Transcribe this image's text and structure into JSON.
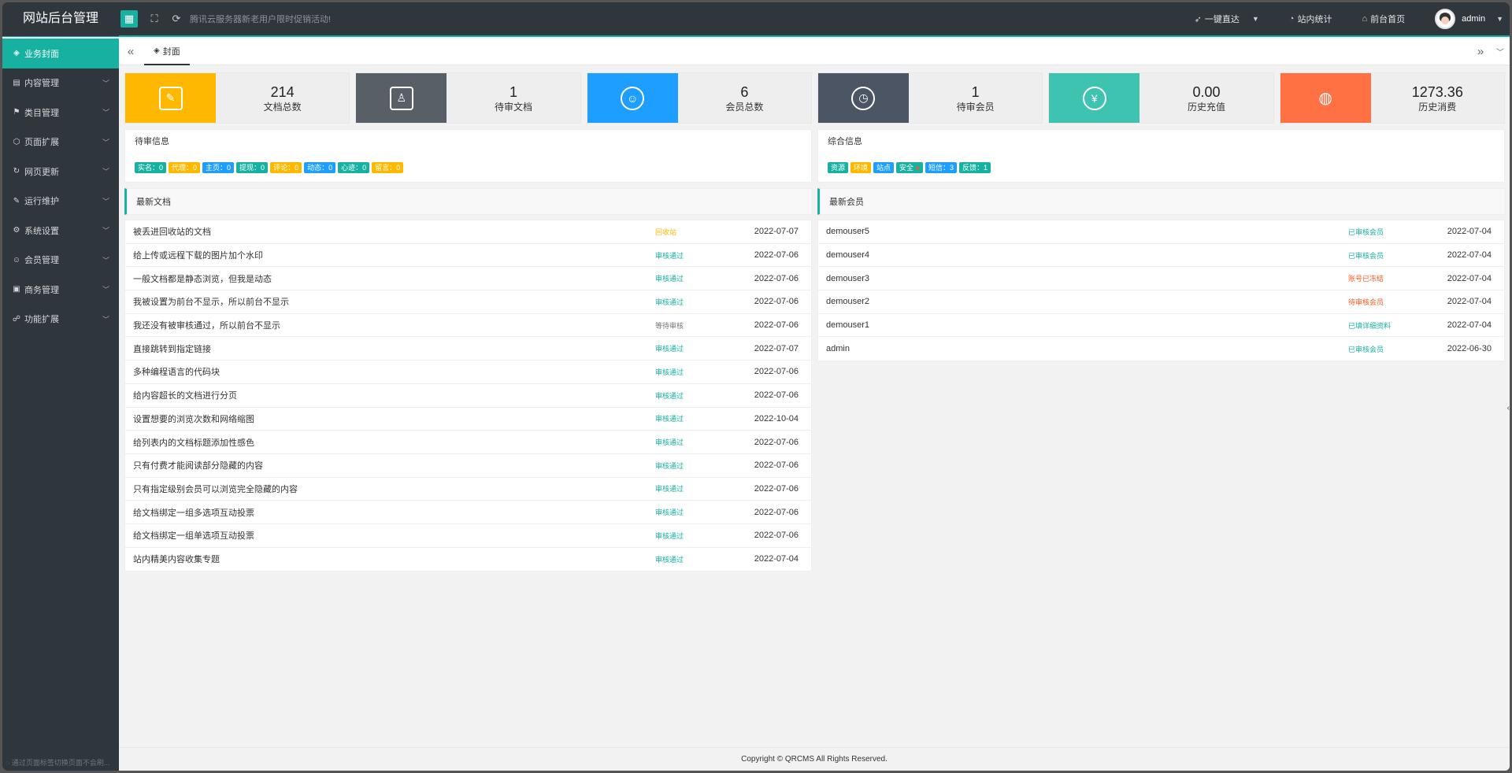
{
  "header": {
    "title": "网站后台管理",
    "notice": "腾讯云服务器新老用户限时促销活动!",
    "quick_link": "一键直达",
    "stats_link": "站内统计",
    "home_link": "前台首页",
    "user": "admin"
  },
  "sidebar": {
    "items": [
      {
        "label": "业务封面",
        "icon": "cover-icon"
      },
      {
        "label": "内容管理",
        "icon": "content-icon"
      },
      {
        "label": "类目管理",
        "icon": "category-icon"
      },
      {
        "label": "页面扩展",
        "icon": "page-icon"
      },
      {
        "label": "网页更新",
        "icon": "update-icon"
      },
      {
        "label": "运行维护",
        "icon": "wrench-icon"
      },
      {
        "label": "系统设置",
        "icon": "gear-icon"
      },
      {
        "label": "会员管理",
        "icon": "user-icon"
      },
      {
        "label": "商务管理",
        "icon": "business-icon"
      },
      {
        "label": "功能扩展",
        "icon": "extension-icon"
      }
    ],
    "footer_tip": "通过页面标签切换页面不会刷..."
  },
  "tabs": {
    "active": "封面"
  },
  "stats": [
    {
      "value": "214",
      "label": "文档总数",
      "color": "#ffb800"
    },
    {
      "value": "1",
      "label": "待审文档",
      "color": "#595f66"
    },
    {
      "value": "6",
      "label": "会员总数",
      "color": "#1e9fff"
    },
    {
      "value": "1",
      "label": "待审会员",
      "color": "#4b5563"
    },
    {
      "value": "0.00",
      "label": "历史充值",
      "color": "#3ec3b0"
    },
    {
      "value": "1273.36",
      "label": "历史消费",
      "color": "#ff7043"
    }
  ],
  "pending": {
    "title": "待审信息",
    "badges": [
      {
        "text": "实名：0",
        "color": "teal"
      },
      {
        "text": "代理：0",
        "color": "orange"
      },
      {
        "text": "主页：0",
        "color": "blue"
      },
      {
        "text": "提现：0",
        "color": "teal"
      },
      {
        "text": "评论：0",
        "color": "orange"
      },
      {
        "text": "动态：0",
        "color": "blue"
      },
      {
        "text": "心迹：0",
        "color": "teal"
      },
      {
        "text": "留言：0",
        "color": "orange"
      }
    ]
  },
  "general": {
    "title": "综合信息",
    "badges": [
      {
        "text": "资源",
        "color": "teal"
      },
      {
        "text": "环境",
        "color": "orange"
      },
      {
        "text": "站点",
        "color": "blue"
      },
      {
        "text": "安全",
        "color": "teal"
      },
      {
        "text": "短信：3",
        "color": "blue"
      },
      {
        "text": "反馈：1",
        "color": "teal"
      }
    ]
  },
  "latest_docs": {
    "title": "最新文档",
    "rows": [
      {
        "title": "被丢进回收站的文档",
        "status": "回收站",
        "tone": "orange",
        "date": "2022-07-07"
      },
      {
        "title": "给上传或远程下载的图片加个水印",
        "status": "审核通过",
        "tone": "green",
        "date": "2022-07-06"
      },
      {
        "title": "一般文档都是静态浏览，但我是动态",
        "status": "审核通过",
        "tone": "green",
        "date": "2022-07-06"
      },
      {
        "title": "我被设置为前台不显示，所以前台不显示",
        "status": "审核通过",
        "tone": "green",
        "date": "2022-07-06"
      },
      {
        "title": "我还没有被审核通过，所以前台不显示",
        "status": "等待审核",
        "tone": "gray",
        "date": "2022-07-06"
      },
      {
        "title": "直接跳转到指定链接",
        "status": "审核通过",
        "tone": "green",
        "date": "2022-07-07"
      },
      {
        "title": "多种编程语言的代码块",
        "status": "审核通过",
        "tone": "green",
        "date": "2022-07-06"
      },
      {
        "title": "给内容超长的文档进行分页",
        "status": "审核通过",
        "tone": "green",
        "date": "2022-07-06"
      },
      {
        "title": "设置想要的浏览次数和网络缩图",
        "status": "审核通过",
        "tone": "green",
        "date": "2022-10-04"
      },
      {
        "title": "给列表内的文档标题添加性感色",
        "status": "审核通过",
        "tone": "green",
        "date": "2022-07-06"
      },
      {
        "title": "只有付费才能阅读部分隐藏的内容",
        "status": "审核通过",
        "tone": "green",
        "date": "2022-07-06"
      },
      {
        "title": "只有指定级别会员可以浏览完全隐藏的内容",
        "status": "审核通过",
        "tone": "green",
        "date": "2022-07-06"
      },
      {
        "title": "给文档绑定一组多选项互动投票",
        "status": "审核通过",
        "tone": "green",
        "date": "2022-07-06"
      },
      {
        "title": "给文档绑定一组单选项互动投票",
        "status": "审核通过",
        "tone": "green",
        "date": "2022-07-06"
      },
      {
        "title": "站内精美内容收集专题",
        "status": "审核通过",
        "tone": "green",
        "date": "2022-07-04"
      }
    ]
  },
  "latest_members": {
    "title": "最新会员",
    "rows": [
      {
        "name": "demouser5",
        "status": "已审核会员",
        "tone": "green",
        "date": "2022-07-04"
      },
      {
        "name": "demouser4",
        "status": "已审核会员",
        "tone": "green",
        "date": "2022-07-04"
      },
      {
        "name": "demouser3",
        "status": "账号已冻结",
        "tone": "red",
        "date": "2022-07-04"
      },
      {
        "name": "demouser2",
        "status": "待审核会员",
        "tone": "red",
        "date": "2022-07-04"
      },
      {
        "name": "demouser1",
        "status": "已填详细资料",
        "tone": "green",
        "date": "2022-07-04"
      },
      {
        "name": "admin",
        "status": "已审核会员",
        "tone": "green",
        "date": "2022-06-30"
      }
    ]
  },
  "footer": {
    "copyright": "Copyright © QRCMS All Rights Reserved."
  }
}
